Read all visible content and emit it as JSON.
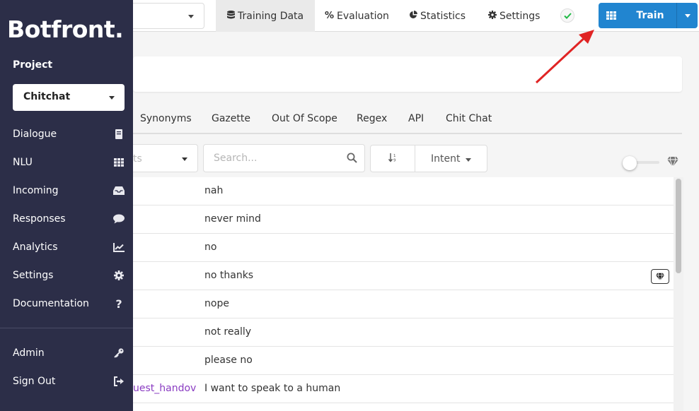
{
  "sidebar": {
    "logo": "Botfront.",
    "project_label": "Project",
    "project_selected": "Chitchat",
    "items": [
      {
        "label": "Dialogue",
        "icon": "book-icon"
      },
      {
        "label": "NLU",
        "icon": "grid-icon"
      },
      {
        "label": "Incoming",
        "icon": "inbox-icon"
      },
      {
        "label": "Responses",
        "icon": "comment-icon"
      },
      {
        "label": "Analytics",
        "icon": "chart-icon"
      },
      {
        "label": "Settings",
        "icon": "gear-icon"
      },
      {
        "label": "Documentation",
        "icon": "question-icon"
      }
    ],
    "bottom_items": [
      {
        "label": "Admin",
        "icon": "key-icon"
      },
      {
        "label": "Sign Out",
        "icon": "sign-out-icon"
      }
    ]
  },
  "topbar": {
    "tabs": [
      {
        "label": "Training Data",
        "icon": "database-icon"
      },
      {
        "label": "Evaluation",
        "icon": "percent-icon"
      },
      {
        "label": "Statistics",
        "icon": "pie-chart-icon"
      },
      {
        "label": "Settings",
        "icon": "gear-icon"
      }
    ],
    "train_label": "Train"
  },
  "subtabs": [
    "Synonyms",
    "Gazette",
    "Out Of Scope",
    "Regex",
    "API",
    "Chit Chat"
  ],
  "filters": {
    "intent_filter_placeholder": "ts",
    "search_placeholder": "Search...",
    "sort_icon": "sort-icon",
    "intent_button_label": "Intent"
  },
  "rows": [
    {
      "intent": "",
      "example": "nah",
      "canonical": false
    },
    {
      "intent": "",
      "example": "never mind",
      "canonical": false
    },
    {
      "intent": "",
      "example": "no",
      "canonical": false
    },
    {
      "intent": "",
      "example": "no thanks",
      "canonical": true
    },
    {
      "intent": "",
      "example": "nope",
      "canonical": false
    },
    {
      "intent": "",
      "example": "not really",
      "canonical": false
    },
    {
      "intent": "",
      "example": "please no",
      "canonical": false
    },
    {
      "intent": "uest_handov",
      "example": "I want to speak to a human",
      "canonical": false
    }
  ],
  "colors": {
    "sidebar_bg": "#2c2e48",
    "primary": "#2185d0",
    "intent_text": "#8a3cc2",
    "annotation_arrow": "#e02424",
    "check_green": "#21ba45"
  }
}
